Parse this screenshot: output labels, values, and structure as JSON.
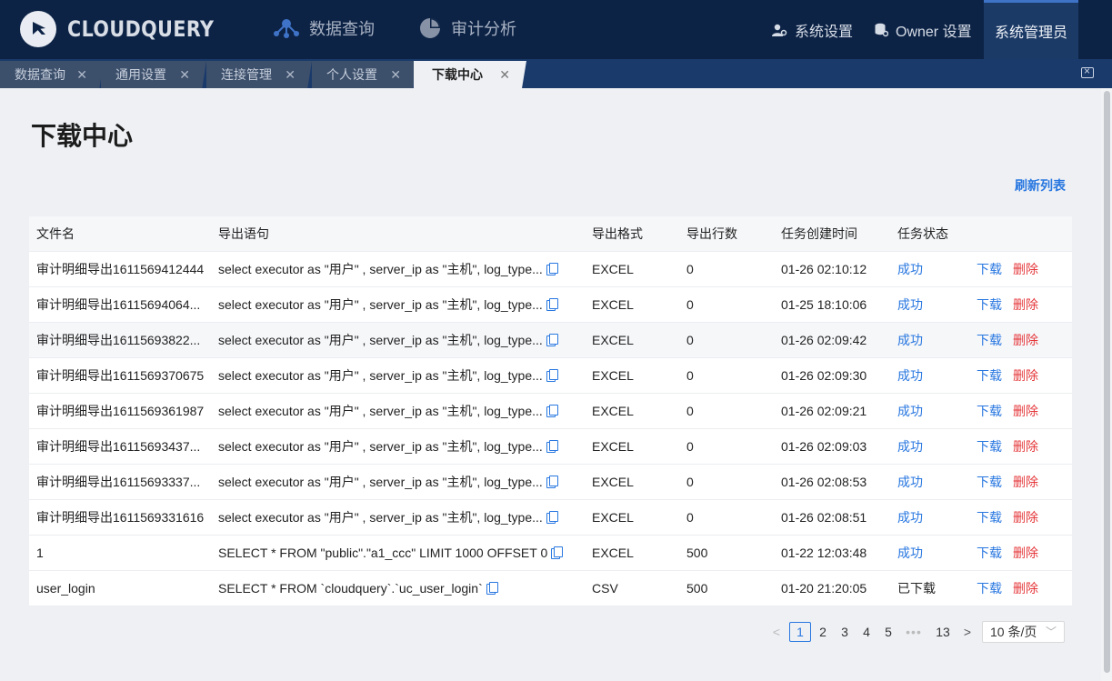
{
  "brand": {
    "name": "CLOUDQUERY"
  },
  "topnav": {
    "query": "数据查询",
    "audit": "审计分析",
    "system_settings": "系统设置",
    "owner_settings": "Owner 设置",
    "admin": "系统管理员"
  },
  "tabs": [
    {
      "label": "数据查询",
      "active": false
    },
    {
      "label": "通用设置",
      "active": false
    },
    {
      "label": "连接管理",
      "active": false
    },
    {
      "label": "个人设置",
      "active": false
    },
    {
      "label": "下载中心",
      "active": true
    }
  ],
  "page": {
    "title": "下载中心",
    "refresh": "刷新列表"
  },
  "table": {
    "columns": [
      "文件名",
      "导出语句",
      "导出格式",
      "导出行数",
      "任务创建时间",
      "任务状态"
    ],
    "rows": [
      {
        "name": "审计明细导出1611569412444",
        "sql": "select executor as \"用户\" , server_ip as \"主机\", log_type...",
        "format": "EXCEL",
        "rows": "0",
        "time": "01-26 02:10:12",
        "status": "成功",
        "download": "下载",
        "delete": "删除"
      },
      {
        "name": "审计明细导出16115694064...",
        "sql": "select executor as \"用户\" , server_ip as \"主机\", log_type...",
        "format": "EXCEL",
        "rows": "0",
        "time": "01-25 18:10:06",
        "status": "成功",
        "download": "下载",
        "delete": "删除"
      },
      {
        "name": "审计明细导出16115693822...",
        "sql": "select executor as \"用户\" , server_ip as \"主机\", log_type...",
        "format": "EXCEL",
        "rows": "0",
        "time": "01-26 02:09:42",
        "status": "成功",
        "download": "下载",
        "delete": "删除"
      },
      {
        "name": "审计明细导出1611569370675",
        "sql": "select executor as \"用户\" , server_ip as \"主机\", log_type...",
        "format": "EXCEL",
        "rows": "0",
        "time": "01-26 02:09:30",
        "status": "成功",
        "download": "下载",
        "delete": "删除"
      },
      {
        "name": "审计明细导出1611569361987",
        "sql": "select executor as \"用户\" , server_ip as \"主机\", log_type...",
        "format": "EXCEL",
        "rows": "0",
        "time": "01-26 02:09:21",
        "status": "成功",
        "download": "下载",
        "delete": "删除"
      },
      {
        "name": "审计明细导出16115693437...",
        "sql": "select executor as \"用户\" , server_ip as \"主机\", log_type...",
        "format": "EXCEL",
        "rows": "0",
        "time": "01-26 02:09:03",
        "status": "成功",
        "download": "下载",
        "delete": "删除"
      },
      {
        "name": "审计明细导出16115693337...",
        "sql": "select executor as \"用户\" , server_ip as \"主机\", log_type...",
        "format": "EXCEL",
        "rows": "0",
        "time": "01-26 02:08:53",
        "status": "成功",
        "download": "下载",
        "delete": "删除"
      },
      {
        "name": "审计明细导出1611569331616",
        "sql": "select executor as \"用户\" , server_ip as \"主机\", log_type...",
        "format": "EXCEL",
        "rows": "0",
        "time": "01-26 02:08:51",
        "status": "成功",
        "download": "下载",
        "delete": "删除"
      },
      {
        "name": "1",
        "sql": "SELECT * FROM \"public\".\"a1_ccc\" LIMIT 1000 OFFSET 0",
        "format": "EXCEL",
        "rows": "500",
        "time": "01-22 12:03:48",
        "status": "成功",
        "download": "下载",
        "delete": "删除"
      },
      {
        "name": "user_login",
        "sql": "SELECT * FROM `cloudquery`.`uc_user_login`",
        "format": "CSV",
        "rows": "500",
        "time": "01-20 21:20:05",
        "status": "已下载",
        "download": "下载",
        "delete": "删除"
      }
    ]
  },
  "pagination": {
    "prev": "<",
    "pages": [
      "1",
      "2",
      "3",
      "4",
      "5"
    ],
    "dots": "•••",
    "last": "13",
    "next": ">",
    "page_size": "10 条/页",
    "current": "1"
  },
  "colors": {
    "nav_bg": "#0d2346",
    "tabbar_bg": "#1a3a6b",
    "link": "#2877e0",
    "danger": "#e5383b"
  }
}
